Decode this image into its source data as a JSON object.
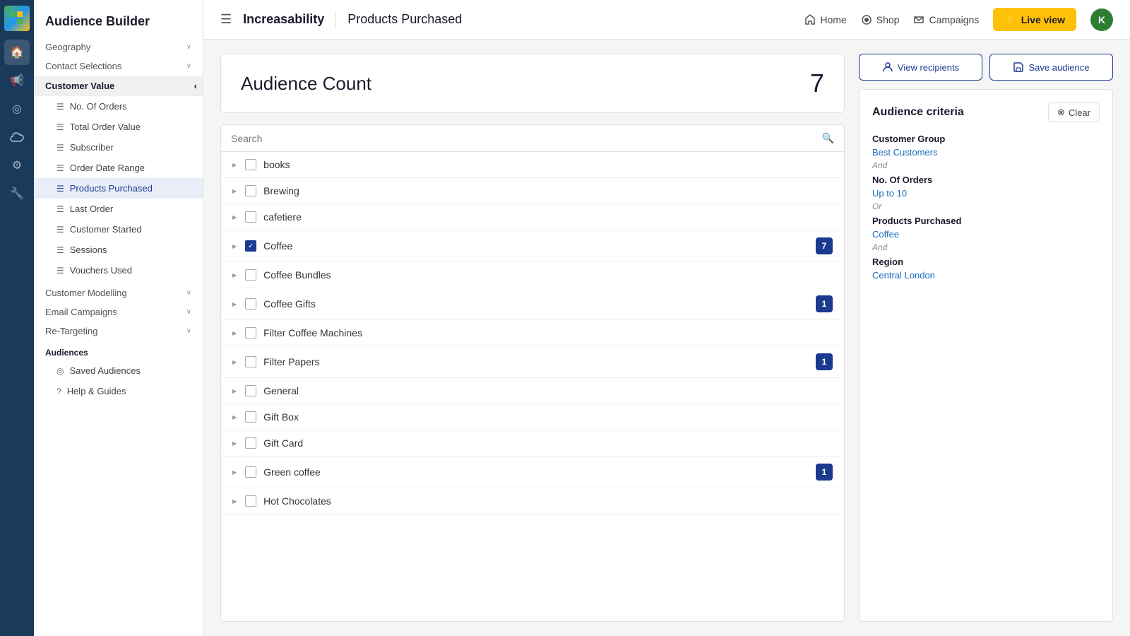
{
  "brand": {
    "name": "Increasability",
    "avatar_initial": "K"
  },
  "topnav": {
    "hamburger_icon": "☰",
    "page_title": "Products Purchased",
    "home_label": "Home",
    "shop_label": "Shop",
    "campaigns_label": "Campaigns",
    "live_view_label": "Live view"
  },
  "sidebar": {
    "header": "Audience Builder",
    "sections": [
      {
        "label": "Geography",
        "has_chevron": true
      },
      {
        "label": "Contact Selections",
        "has_chevron": true
      }
    ],
    "customer_value": {
      "label": "Customer Value",
      "chevron": "‹"
    },
    "sub_items": [
      {
        "label": "No. Of Orders",
        "active": false
      },
      {
        "label": "Total Order Value",
        "active": false
      },
      {
        "label": "Subscriber",
        "active": false
      },
      {
        "label": "Order Date Range",
        "active": false
      },
      {
        "label": "Products Purchased",
        "active": true
      },
      {
        "label": "Last Order",
        "active": false
      },
      {
        "label": "Customer Started",
        "active": false
      },
      {
        "label": "Sessions",
        "active": false
      },
      {
        "label": "Vouchers Used",
        "active": false
      }
    ],
    "bottom_sections": [
      {
        "label": "Customer Modelling",
        "has_chevron": true
      },
      {
        "label": "Email Campaigns",
        "has_chevron": true
      },
      {
        "label": "Re-Targeting",
        "has_chevron": true
      }
    ],
    "audiences": {
      "header": "Audiences",
      "items": [
        {
          "label": "Saved Audiences"
        },
        {
          "label": "Help & Guides"
        }
      ]
    }
  },
  "icon_bar": {
    "items": [
      "⊞",
      "🏠",
      "📢",
      "◎",
      "☁",
      "⚙",
      "🔧"
    ]
  },
  "audience_count": {
    "label": "Audience Count",
    "value": "7"
  },
  "search": {
    "placeholder": "Search"
  },
  "products": [
    {
      "name": "books",
      "checked": false,
      "badge": null
    },
    {
      "name": "Brewing",
      "checked": false,
      "badge": null
    },
    {
      "name": "cafetiere",
      "checked": false,
      "badge": null
    },
    {
      "name": "Coffee",
      "checked": true,
      "badge": "7"
    },
    {
      "name": "Coffee Bundles",
      "checked": false,
      "badge": null
    },
    {
      "name": "Coffee Gifts",
      "checked": false,
      "badge": "1"
    },
    {
      "name": "Filter Coffee Machines",
      "checked": false,
      "badge": null
    },
    {
      "name": "Filter Papers",
      "checked": false,
      "badge": "1"
    },
    {
      "name": "General",
      "checked": false,
      "badge": null
    },
    {
      "name": "Gift Box",
      "checked": false,
      "badge": null
    },
    {
      "name": "Gift Card",
      "checked": false,
      "badge": null
    },
    {
      "name": "Green coffee",
      "checked": false,
      "badge": "1"
    },
    {
      "name": "Hot Chocolates",
      "checked": false,
      "badge": null
    }
  ],
  "action_buttons": {
    "view_recipients": "View recipients",
    "save_audience": "Save audience"
  },
  "criteria": {
    "title": "Audience criteria",
    "clear_label": "Clear",
    "sections": [
      {
        "section_title": "Customer Group",
        "value": "Best Customers",
        "connector": "And"
      },
      {
        "section_title": "No. Of Orders",
        "value": "Up to 10",
        "connector": "Or"
      },
      {
        "section_title": "Products Purchased",
        "value": "Coffee",
        "connector": "And"
      },
      {
        "section_title": "Region",
        "value": "Central London",
        "connector": null
      }
    ]
  }
}
